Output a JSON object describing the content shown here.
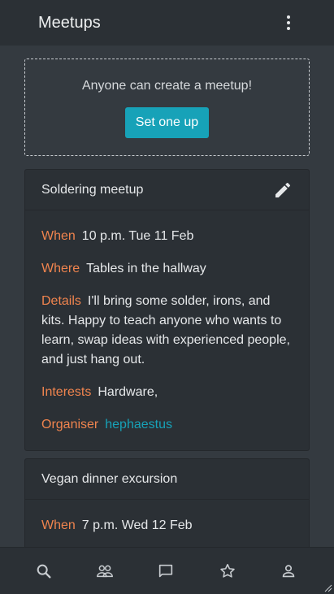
{
  "app": {
    "title": "Meetups"
  },
  "create": {
    "text": "Anyone can create a meetup!",
    "button": "Set one up"
  },
  "labels": {
    "when": "When",
    "where": "Where",
    "details": "Details",
    "interests": "Interests",
    "organiser": "Organiser"
  },
  "meetups": [
    {
      "title": "Soldering meetup",
      "when": "10 p.m. Tue 11 Feb",
      "where": "Tables in the hallway",
      "details": "I'll bring some solder, irons, and kits. Happy to teach anyone who wants to learn, swap ideas with experienced people, and just hang out.",
      "interests": "Hardware,",
      "organiser": "hephaestus"
    },
    {
      "title": "Vegan dinner excursion",
      "when": "7 p.m. Wed 12 Feb"
    }
  ],
  "nav": [
    "search-icon",
    "people-icon",
    "chat-icon",
    "star-icon",
    "person-icon"
  ],
  "colors": {
    "accent": "#17a2b8",
    "label": "#f0844e",
    "background": "#343a40",
    "surface": "#2b3035"
  }
}
